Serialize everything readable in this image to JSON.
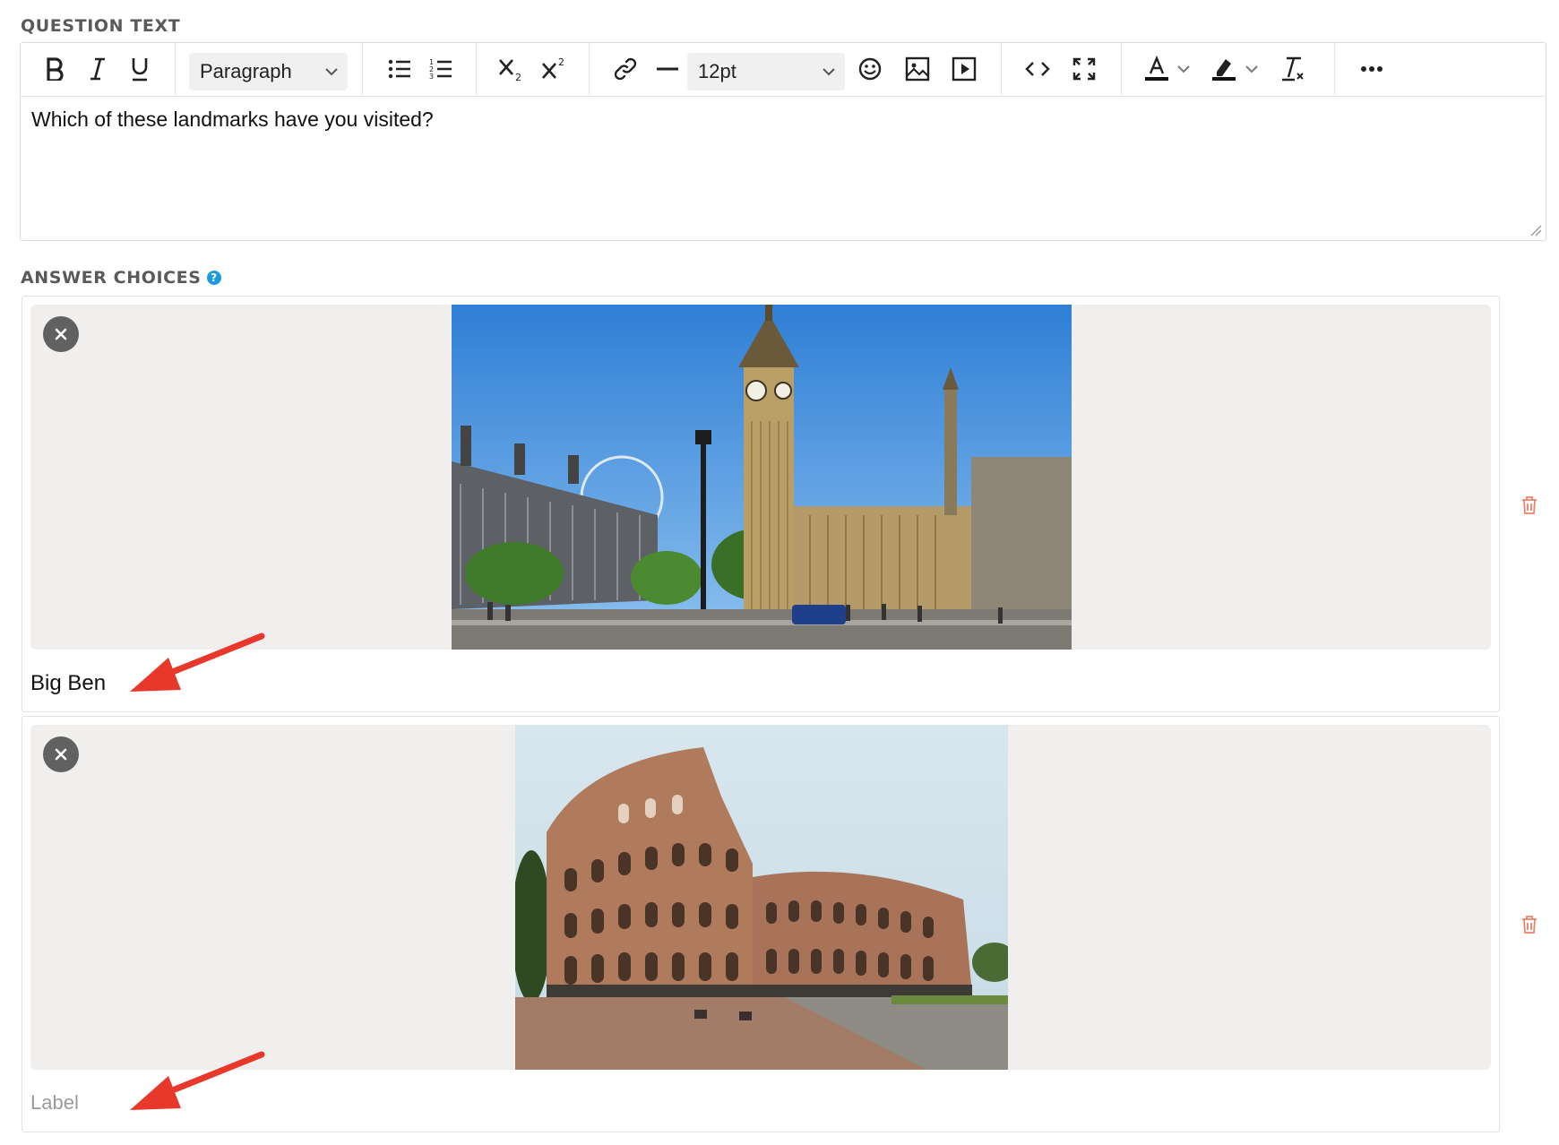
{
  "question_section": {
    "label": "QUESTION TEXT",
    "block_format": "Paragraph",
    "font_size": "12pt",
    "text": "Which of these landmarks have you visited?"
  },
  "toolbar_icons": [
    "bold-icon",
    "italic-icon",
    "underline-icon",
    "bullet-list-icon",
    "numbered-list-icon",
    "subscript-icon",
    "superscript-icon",
    "link-icon",
    "horizontal-rule-icon",
    "emoji-icon",
    "image-icon",
    "video-icon",
    "code-icon",
    "fullscreen-icon",
    "text-color-icon",
    "highlight-color-icon",
    "clear-format-icon",
    "more-icon"
  ],
  "answers_section": {
    "label": "ANSWER CHOICES",
    "help": "?"
  },
  "choices": [
    {
      "label": "Big Ben",
      "image": "Big Ben and Palace of Westminster, London"
    },
    {
      "label": "",
      "placeholder": "Label",
      "image": "Colosseum, Rome"
    }
  ],
  "colors": {
    "accent_help": "#1a9be0",
    "trash": "#e8826a",
    "arrow": "#e8372b",
    "image_area_bg": "#f0efed",
    "section_label": "#5a5a5a"
  }
}
